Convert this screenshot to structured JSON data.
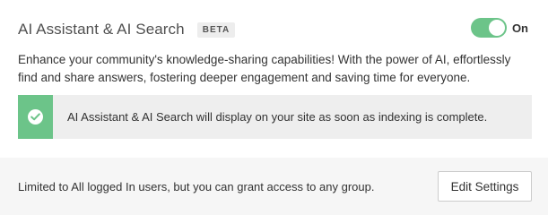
{
  "header": {
    "title": "AI Assistant & AI Search",
    "badge": "BETA",
    "toggle": {
      "state": "on",
      "label": "On",
      "color": "#6cc489"
    }
  },
  "description": "Enhance your community's knowledge-sharing capabilities! With the power of AI, effortlessly find and share answers, fostering deeper engagement and saving time for everyone.",
  "notice": {
    "icon": "check-circle-icon",
    "text": "AI Assistant & AI Search will display on your site as soon as indexing is complete."
  },
  "footer": {
    "access_text": "Limited to All logged In users, but you can grant access to any group.",
    "edit_button_label": "Edit Settings"
  }
}
